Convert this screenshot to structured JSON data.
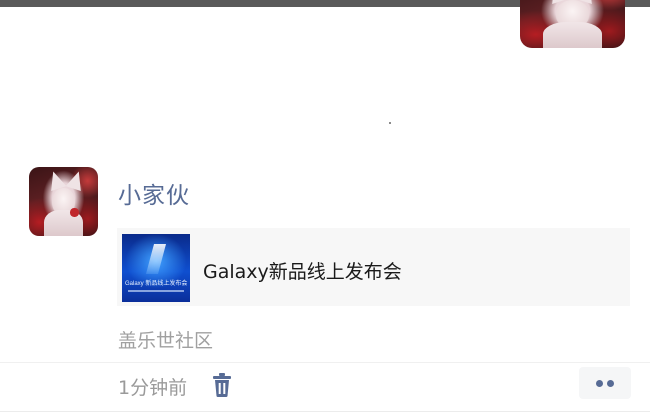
{
  "post": {
    "username": "小家伙",
    "link": {
      "title": "Galaxy新品线上发布会",
      "thumbnail_text": "Galaxy 新品线上发布会"
    },
    "source": "盖乐世社区",
    "time": "1分钟前"
  },
  "icons": {
    "delete": "trash-icon",
    "more": "more-dots-icon"
  },
  "colors": {
    "name_link": "#576b95",
    "meta_text": "#9a9a9a",
    "card_bg": "#f7f7f7"
  }
}
